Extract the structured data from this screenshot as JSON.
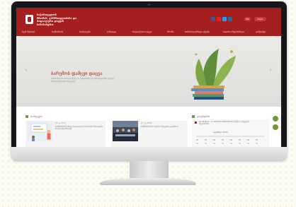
{
  "header": {
    "title_lines": [
      "საქართველოს",
      "შრომის, ჯანმრთელობისა და",
      "სოციალური დაცვის",
      "სამინისტრო"
    ],
    "buttons": {
      "lang": "EN",
      "search": "ძიება"
    }
  },
  "nav": {
    "items": [
      "ჩვენ შესახებ",
      "საქმიანობა",
      "სიახლეები",
      "ჯანდაცვა",
      "სოციალური დაცვა",
      "შრომა",
      "სამართლებრივი აქტები",
      "საჯარო ინფორმაცია",
      "კონტაქტი"
    ]
  },
  "hero": {
    "title": "ბარემოს დამცვი დაცვა",
    "text": "სამინისტროს პროგრამები და სერვისები ხელმისაწვდომია ყველა მოქალაქისთვის სრულად"
  },
  "news": {
    "heading": "სიახლეები",
    "items": [
      {
        "date": "20 აგვ 2023",
        "text": "სამინისტრომ ახალი სოციალური პროგრამა წარადგინა მოქალაქეებისთვის"
      },
      {
        "date": "18 აგვ 2023",
        "text": "სამინისტროში სამუშაო შეხვედრა გაიმართა"
      }
    ]
  },
  "events": {
    "heading": "კალენდარი",
    "item_text": "20.08.2023 - 21.08.2023 სამინისტროს სამუშაო შეხვედრა რეგიონებში",
    "month": "აგვისტო 2023"
  },
  "colors": {
    "brand": "#a51f1f",
    "accent": "#6f9a35"
  }
}
